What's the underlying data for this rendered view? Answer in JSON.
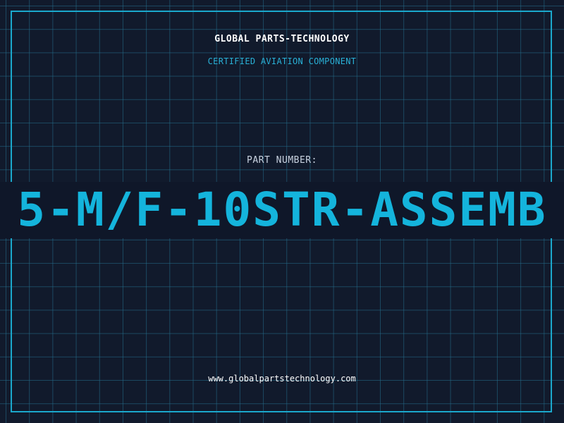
{
  "header": {
    "company": "GLOBAL PARTS-TECHNOLOGY",
    "subtitle": "CERTIFIED AVIATION COMPONENT"
  },
  "part": {
    "label": "PART NUMBER:",
    "number": "5-M/F-10STR-ASSEMB"
  },
  "footer": {
    "website": "www.globalpartstechnology.com"
  },
  "colors": {
    "background": "#111a2c",
    "grid": "#246e8c",
    "accent": "#14b4dc",
    "frame": "#1ba8cc"
  }
}
